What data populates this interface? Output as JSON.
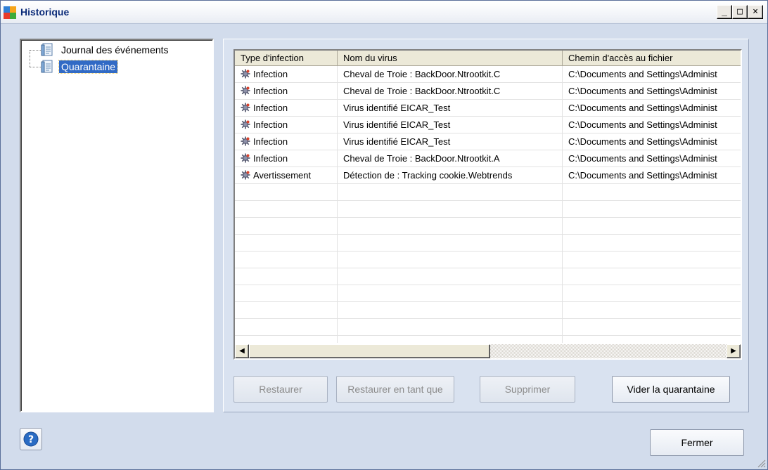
{
  "window": {
    "title": "Historique",
    "controls": [
      "_",
      "□",
      "×"
    ]
  },
  "tree": {
    "items": [
      {
        "label": "Journal des événements",
        "selected": false
      },
      {
        "label": "Quarantaine",
        "selected": true
      }
    ]
  },
  "table": {
    "columns": [
      "Type d'infection",
      "Nom du virus",
      "Chemin d'accès au fichier"
    ],
    "rows": [
      {
        "type": "Infection",
        "name": "Cheval de Troie : BackDoor.Ntrootkit.C",
        "path": "C:\\Documents and Settings\\Administ"
      },
      {
        "type": "Infection",
        "name": "Cheval de Troie : BackDoor.Ntrootkit.C",
        "path": "C:\\Documents and Settings\\Administ"
      },
      {
        "type": "Infection",
        "name": "Virus identifié EICAR_Test",
        "path": "C:\\Documents and Settings\\Administ"
      },
      {
        "type": "Infection",
        "name": "Virus identifié EICAR_Test",
        "path": "C:\\Documents and Settings\\Administ"
      },
      {
        "type": "Infection",
        "name": "Virus identifié EICAR_Test",
        "path": "C:\\Documents and Settings\\Administ"
      },
      {
        "type": "Infection",
        "name": "Cheval de Troie : BackDoor.Ntrootkit.A",
        "path": "C:\\Documents and Settings\\Administ"
      },
      {
        "type": "Avertissement",
        "name": "Détection de : Tracking cookie.Webtrends",
        "path": "C:\\Documents and Settings\\Administ"
      }
    ]
  },
  "buttons": {
    "restore": "Restaurer",
    "restore_as": "Restaurer en tant que",
    "delete": "Supprimer",
    "empty_quarantine": "Vider la quarantaine",
    "close": "Fermer"
  },
  "icons": {
    "help": "help-icon",
    "app": "avg-logo-icon",
    "row": "virus-icon"
  },
  "colors": {
    "selection": "#316ac5",
    "title": "#0a2a78"
  }
}
